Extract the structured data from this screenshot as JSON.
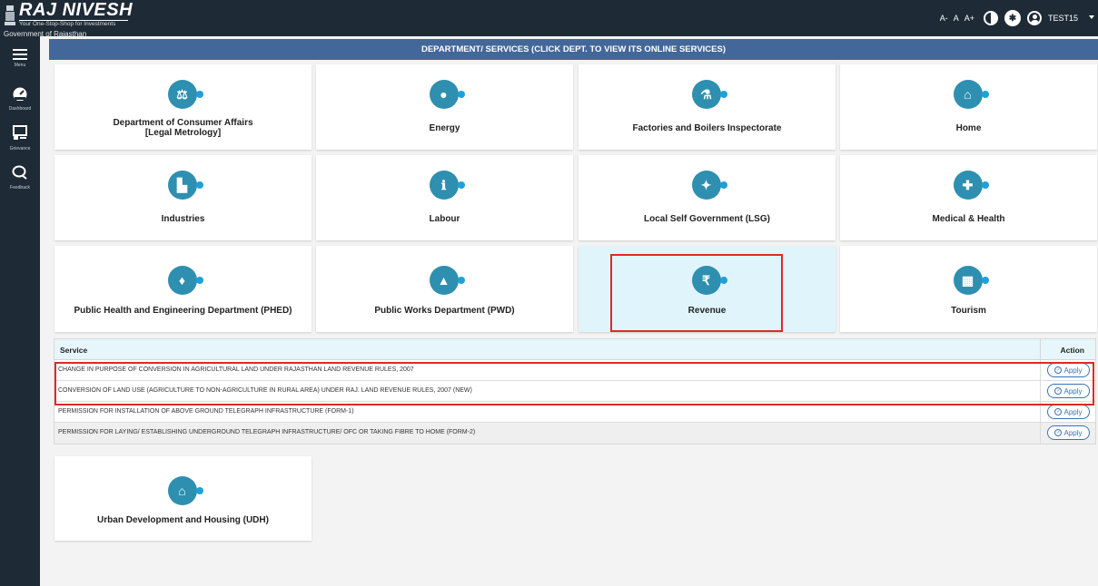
{
  "header": {
    "brand": "RAJ NIVESH",
    "tagline": "Your One-Stop-Shop for Investments",
    "government": "Government of Rajasthan",
    "font_small": "A-",
    "font_normal": "A",
    "font_large": "A+",
    "username": "TEST15"
  },
  "sidebar": {
    "items": [
      {
        "label": "Menu"
      },
      {
        "label": "Dashboard"
      },
      {
        "label": "Grievance"
      },
      {
        "label": "Feedback"
      }
    ]
  },
  "section_title": "DEPARTMENT/ SERVICES (CLICK DEPT. TO VIEW ITS ONLINE SERVICES)",
  "departments": [
    {
      "label": "Department of Consumer Affairs",
      "label2": "[Legal Metrology]",
      "icon": "scales-icon",
      "glyph": "⚖"
    },
    {
      "label": "Energy",
      "icon": "bulb-icon",
      "glyph": "💡"
    },
    {
      "label": "Factories and Boilers Inspectorate",
      "icon": "flask-icon",
      "glyph": "⚗"
    },
    {
      "label": "Home",
      "icon": "home-icon",
      "glyph": "⌂"
    },
    {
      "label": "Industries",
      "icon": "factory-icon",
      "glyph": "▙"
    },
    {
      "label": "Labour",
      "icon": "worker-icon",
      "glyph": "ℹ"
    },
    {
      "label": "Local Self Government (LSG)",
      "icon": "people-icon",
      "glyph": "👥"
    },
    {
      "label": "Medical & Health",
      "icon": "medical-kit-icon",
      "glyph": "✚"
    },
    {
      "label": "Public Health and Engineering Department (PHED)",
      "icon": "water-hand-icon",
      "glyph": "💧"
    },
    {
      "label": "Public Works Department (PWD)",
      "icon": "road-icon",
      "glyph": "▲"
    },
    {
      "label": "Revenue",
      "icon": "rupee-icon",
      "glyph": "₹"
    },
    {
      "label": "Tourism",
      "icon": "building-icon",
      "glyph": "▦"
    },
    {
      "label": "Urban Development and Housing (UDH)",
      "icon": "home-icon",
      "glyph": "⌂"
    }
  ],
  "services": {
    "col_service": "Service",
    "col_action": "Action",
    "apply_label": "Apply",
    "rows": [
      {
        "name": "CHANGE IN PURPOSE OF CONVERSION IN AGRICULTURAL LAND UNDER RAJASTHAN LAND REVENUE RULES, 2007"
      },
      {
        "name": "CONVERSION OF LAND USE (AGRICULTURE TO NON-AGRICULTURE IN RURAL AREA) UNDER RAJ. LAND REVENUE RULES, 2007 (NEW)"
      },
      {
        "name": "PERMISSION FOR INSTALLATION OF ABOVE GROUND TELEGRAPH INFRASTRUCTURE (FORM-1)"
      },
      {
        "name": "PERMISSION FOR LAYING/ ESTABLISHING UNDERGROUND TELEGRAPH INFRASTRUCTURE/ OFC OR TAKING FIBRE TO HOME (FORM-2)"
      }
    ]
  },
  "colors": {
    "header_bg": "#1e2a36",
    "section_bar": "#44679a",
    "icon_circle": "#2e8fb0",
    "highlight": "#e02828",
    "active_card": "#e0f5fb"
  }
}
